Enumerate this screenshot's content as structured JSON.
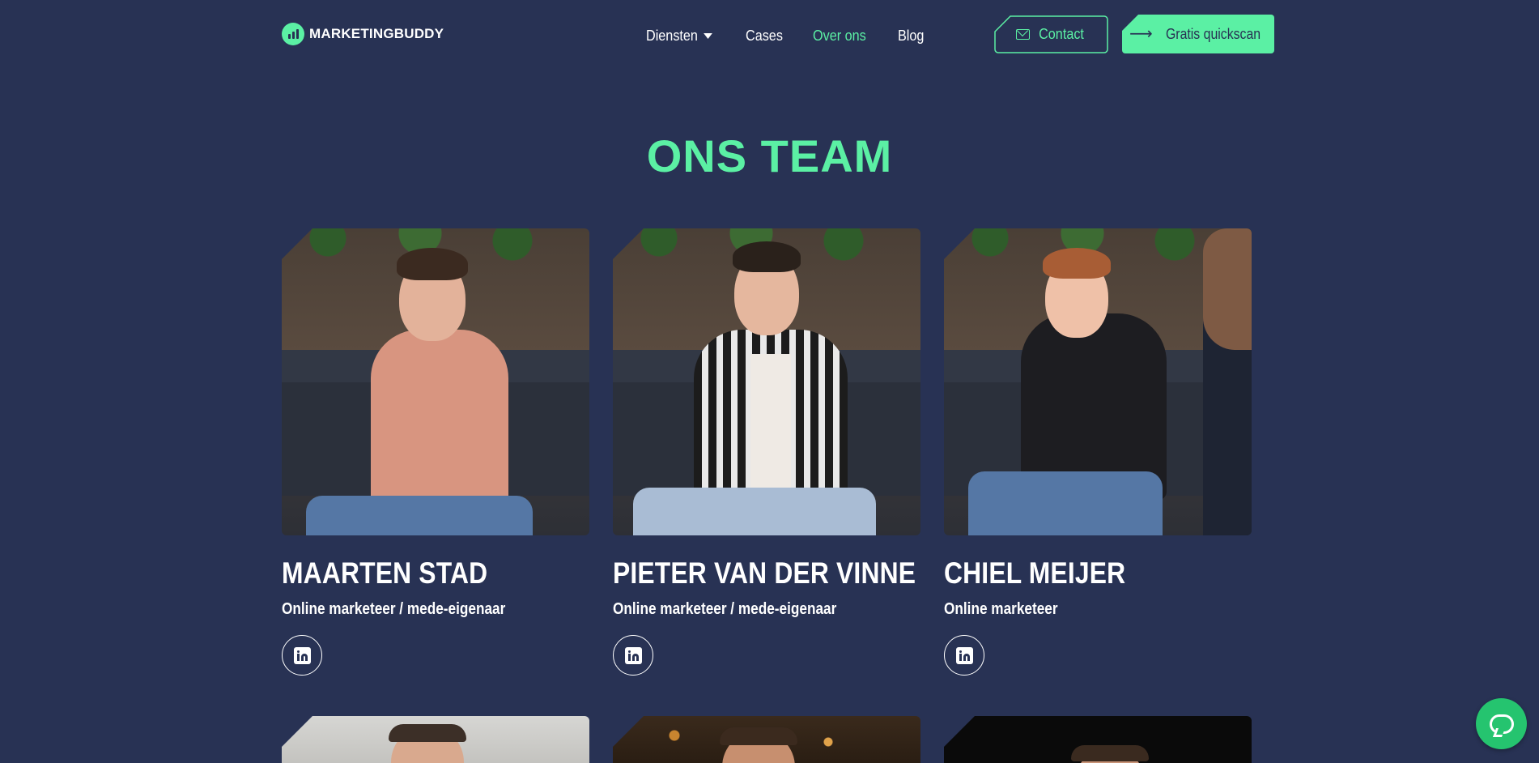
{
  "brand": {
    "name": "MARKETINGBUDDY",
    "accent_color": "#5bf0a4",
    "background_color": "#283254"
  },
  "nav": {
    "items": [
      {
        "label": "Diensten",
        "has_dropdown": true,
        "active": false
      },
      {
        "label": "Cases",
        "has_dropdown": false,
        "active": false
      },
      {
        "label": "Over ons",
        "has_dropdown": false,
        "active": true
      },
      {
        "label": "Blog",
        "has_dropdown": false,
        "active": false
      }
    ],
    "contact_label": "Contact",
    "contact_icon": "mail-icon",
    "quickscan_label": "Gratis quickscan",
    "quickscan_icon": "arrow-right-icon"
  },
  "section": {
    "title": "ONS TEAM"
  },
  "team": [
    {
      "name": "MAARTEN STAD",
      "role": "Online marketeer / mede-eigenaar",
      "social_icon": "linkedin-icon"
    },
    {
      "name": "PIETER VAN DER VINNE",
      "role": "Online marketeer / mede-eigenaar",
      "social_icon": "linkedin-icon"
    },
    {
      "name": "CHIEL MEIJER",
      "role": "Online marketeer",
      "social_icon": "linkedin-icon"
    }
  ],
  "chat_widget": {
    "icon": "chat-bubble-icon",
    "color": "#25c46f"
  }
}
